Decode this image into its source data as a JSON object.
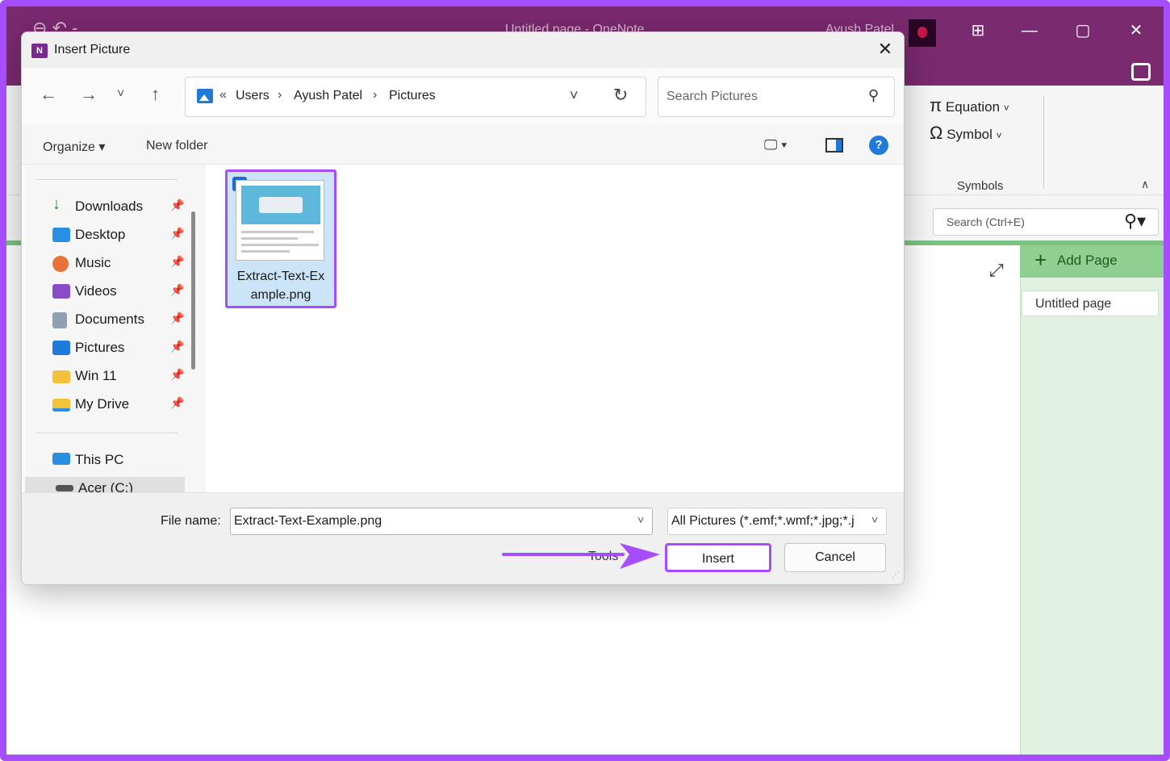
{
  "window": {
    "title": "Untitled page - OneNote",
    "user": "Ayush Patel",
    "controls": [
      "⊞",
      "—",
      "▢",
      "✕"
    ],
    "accent_color": "#7a2a6f",
    "highlight_color": "#a64dff"
  },
  "ribbon": {
    "equation_label": "Equation",
    "symbol_label": "Symbol",
    "group_label": "Symbols"
  },
  "onenote_search": {
    "placeholder": "Search (Ctrl+E)"
  },
  "pages": {
    "add_label": "Add Page",
    "items": [
      {
        "label": "Untitled page"
      }
    ]
  },
  "dialog": {
    "title": "Insert Picture",
    "close_label": "✕",
    "breadcrumb": [
      "Users",
      "Ayush Patel",
      "Pictures"
    ],
    "search_placeholder": "Search Pictures",
    "organize_label": "Organize ▾",
    "new_folder_label": "New folder",
    "help_label": "?",
    "nav_items": [
      {
        "label": "Downloads",
        "icon": "download-icon",
        "pinned": true
      },
      {
        "label": "Desktop",
        "icon": "desktop-folder-icon",
        "pinned": true
      },
      {
        "label": "Music",
        "icon": "music-icon",
        "pinned": true
      },
      {
        "label": "Videos",
        "icon": "videos-icon",
        "pinned": true
      },
      {
        "label": "Documents",
        "icon": "documents-icon",
        "pinned": true
      },
      {
        "label": "Pictures",
        "icon": "pictures-icon",
        "pinned": true
      },
      {
        "label": "Win 11",
        "icon": "folder-icon",
        "pinned": true
      },
      {
        "label": "My Drive",
        "icon": "drive-folder-icon",
        "pinned": true
      },
      {
        "label": "This PC",
        "icon": "computer-icon",
        "pinned": false
      },
      {
        "label": "Acer (C:)",
        "icon": "drive-icon",
        "pinned": false
      }
    ],
    "files": [
      {
        "name": "Extract-Text-Ex ample.png",
        "selected": true
      }
    ],
    "file_name_label": "File name:",
    "file_name_value": "Extract-Text-Example.png",
    "file_type_value": "All Pictures (*.emf;*.wmf;*.jpg;*.j",
    "tools_label": "Tools",
    "insert_label": "Insert",
    "cancel_label": "Cancel"
  }
}
